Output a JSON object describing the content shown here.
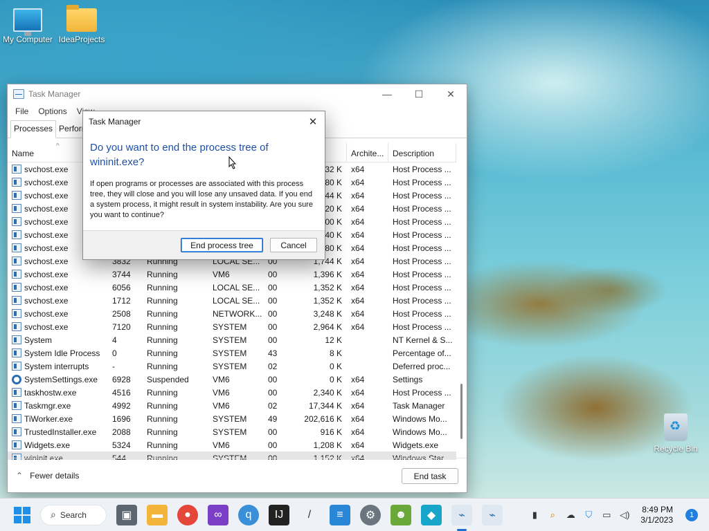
{
  "desktop": {
    "icons": [
      {
        "label": "My Computer"
      },
      {
        "label": "IdeaProjects"
      },
      {
        "label": "Recycle Bin"
      }
    ]
  },
  "task_manager": {
    "title": "Task Manager",
    "menu": [
      "File",
      "Options",
      "View"
    ],
    "tabs": [
      "Processes",
      "Perform"
    ],
    "columns": {
      "name": "Name",
      "memory": "y (a...",
      "architecture": "Archite...",
      "description": "Description"
    },
    "rows": [
      {
        "name": "svchost.exe",
        "pid": "",
        "status": "",
        "user": "",
        "cpu": "",
        "mem": "232 K",
        "arch": "x64",
        "desc": "Host Process ..."
      },
      {
        "name": "svchost.exe",
        "pid": "",
        "status": "",
        "user": "",
        "cpu": "",
        "mem": "280 K",
        "arch": "x64",
        "desc": "Host Process ..."
      },
      {
        "name": "svchost.exe",
        "pid": "",
        "status": "",
        "user": "",
        "cpu": "",
        "mem": "644 K",
        "arch": "x64",
        "desc": "Host Process ..."
      },
      {
        "name": "svchost.exe",
        "pid": "",
        "status": "",
        "user": "",
        "cpu": "",
        "mem": "720 K",
        "arch": "x64",
        "desc": "Host Process ..."
      },
      {
        "name": "svchost.exe",
        "pid": "",
        "status": "",
        "user": "",
        "cpu": "",
        "mem": "700 K",
        "arch": "x64",
        "desc": "Host Process ..."
      },
      {
        "name": "svchost.exe",
        "pid": "",
        "status": "",
        "user": "",
        "cpu": "",
        "mem": "640 K",
        "arch": "x64",
        "desc": "Host Process ..."
      },
      {
        "name": "svchost.exe",
        "pid": "",
        "status": "",
        "user": "",
        "cpu": "",
        "mem": "480 K",
        "arch": "x64",
        "desc": "Host Process ..."
      },
      {
        "name": "svchost.exe",
        "pid": "3832",
        "status": "Running",
        "user": "LOCAL SE...",
        "cpu": "00",
        "mem": "1,744 K",
        "arch": "x64",
        "desc": "Host Process ..."
      },
      {
        "name": "svchost.exe",
        "pid": "3744",
        "status": "Running",
        "user": "VM6",
        "cpu": "00",
        "mem": "1,396 K",
        "arch": "x64",
        "desc": "Host Process ..."
      },
      {
        "name": "svchost.exe",
        "pid": "6056",
        "status": "Running",
        "user": "LOCAL SE...",
        "cpu": "00",
        "mem": "1,352 K",
        "arch": "x64",
        "desc": "Host Process ..."
      },
      {
        "name": "svchost.exe",
        "pid": "1712",
        "status": "Running",
        "user": "LOCAL SE...",
        "cpu": "00",
        "mem": "1,352 K",
        "arch": "x64",
        "desc": "Host Process ..."
      },
      {
        "name": "svchost.exe",
        "pid": "2508",
        "status": "Running",
        "user": "NETWORK...",
        "cpu": "00",
        "mem": "3,248 K",
        "arch": "x64",
        "desc": "Host Process ..."
      },
      {
        "name": "svchost.exe",
        "pid": "7120",
        "status": "Running",
        "user": "SYSTEM",
        "cpu": "00",
        "mem": "2,964 K",
        "arch": "x64",
        "desc": "Host Process ..."
      },
      {
        "name": "System",
        "pid": "4",
        "status": "Running",
        "user": "SYSTEM",
        "cpu": "00",
        "mem": "12 K",
        "arch": "",
        "desc": "NT Kernel & S..."
      },
      {
        "name": "System Idle Process",
        "pid": "0",
        "status": "Running",
        "user": "SYSTEM",
        "cpu": "43",
        "mem": "8 K",
        "arch": "",
        "desc": "Percentage of..."
      },
      {
        "name": "System interrupts",
        "pid": "-",
        "status": "Running",
        "user": "SYSTEM",
        "cpu": "02",
        "mem": "0 K",
        "arch": "",
        "desc": "Deferred proc..."
      },
      {
        "name": "SystemSettings.exe",
        "pid": "6928",
        "status": "Suspended",
        "user": "VM6",
        "cpu": "00",
        "mem": "0 K",
        "arch": "x64",
        "desc": "Settings"
      },
      {
        "name": "taskhostw.exe",
        "pid": "4516",
        "status": "Running",
        "user": "VM6",
        "cpu": "00",
        "mem": "2,340 K",
        "arch": "x64",
        "desc": "Host Process ..."
      },
      {
        "name": "Taskmgr.exe",
        "pid": "4992",
        "status": "Running",
        "user": "VM6",
        "cpu": "02",
        "mem": "17,344 K",
        "arch": "x64",
        "desc": "Task Manager"
      },
      {
        "name": "TiWorker.exe",
        "pid": "1696",
        "status": "Running",
        "user": "SYSTEM",
        "cpu": "49",
        "mem": "202,616 K",
        "arch": "x64",
        "desc": "Windows Mo..."
      },
      {
        "name": "TrustedInstaller.exe",
        "pid": "2088",
        "status": "Running",
        "user": "SYSTEM",
        "cpu": "00",
        "mem": "916 K",
        "arch": "x64",
        "desc": "Windows Mo..."
      },
      {
        "name": "Widgets.exe",
        "pid": "5324",
        "status": "Running",
        "user": "VM6",
        "cpu": "00",
        "mem": "1,208 K",
        "arch": "x64",
        "desc": "Widgets.exe"
      },
      {
        "name": "wininit.exe",
        "pid": "544",
        "status": "Running",
        "user": "SYSTEM",
        "cpu": "00",
        "mem": "1,152 K",
        "arch": "x64",
        "desc": "Windows Star..."
      }
    ],
    "footer": {
      "fewer_details": "Fewer details",
      "end_task": "End task"
    }
  },
  "dialog": {
    "title": "Task Manager",
    "heading": "Do you want to end the process tree of wininit.exe?",
    "body": "If open programs or processes are associated with this process tree, they will close and you will lose any unsaved data. If you end a system process, it might result in system instability. Are you sure you want to continue?",
    "primary": "End process tree",
    "cancel": "Cancel"
  },
  "taskbar": {
    "search_label": "Search",
    "time": "8:49 PM",
    "date": "3/1/2023",
    "notification_count": "1"
  }
}
